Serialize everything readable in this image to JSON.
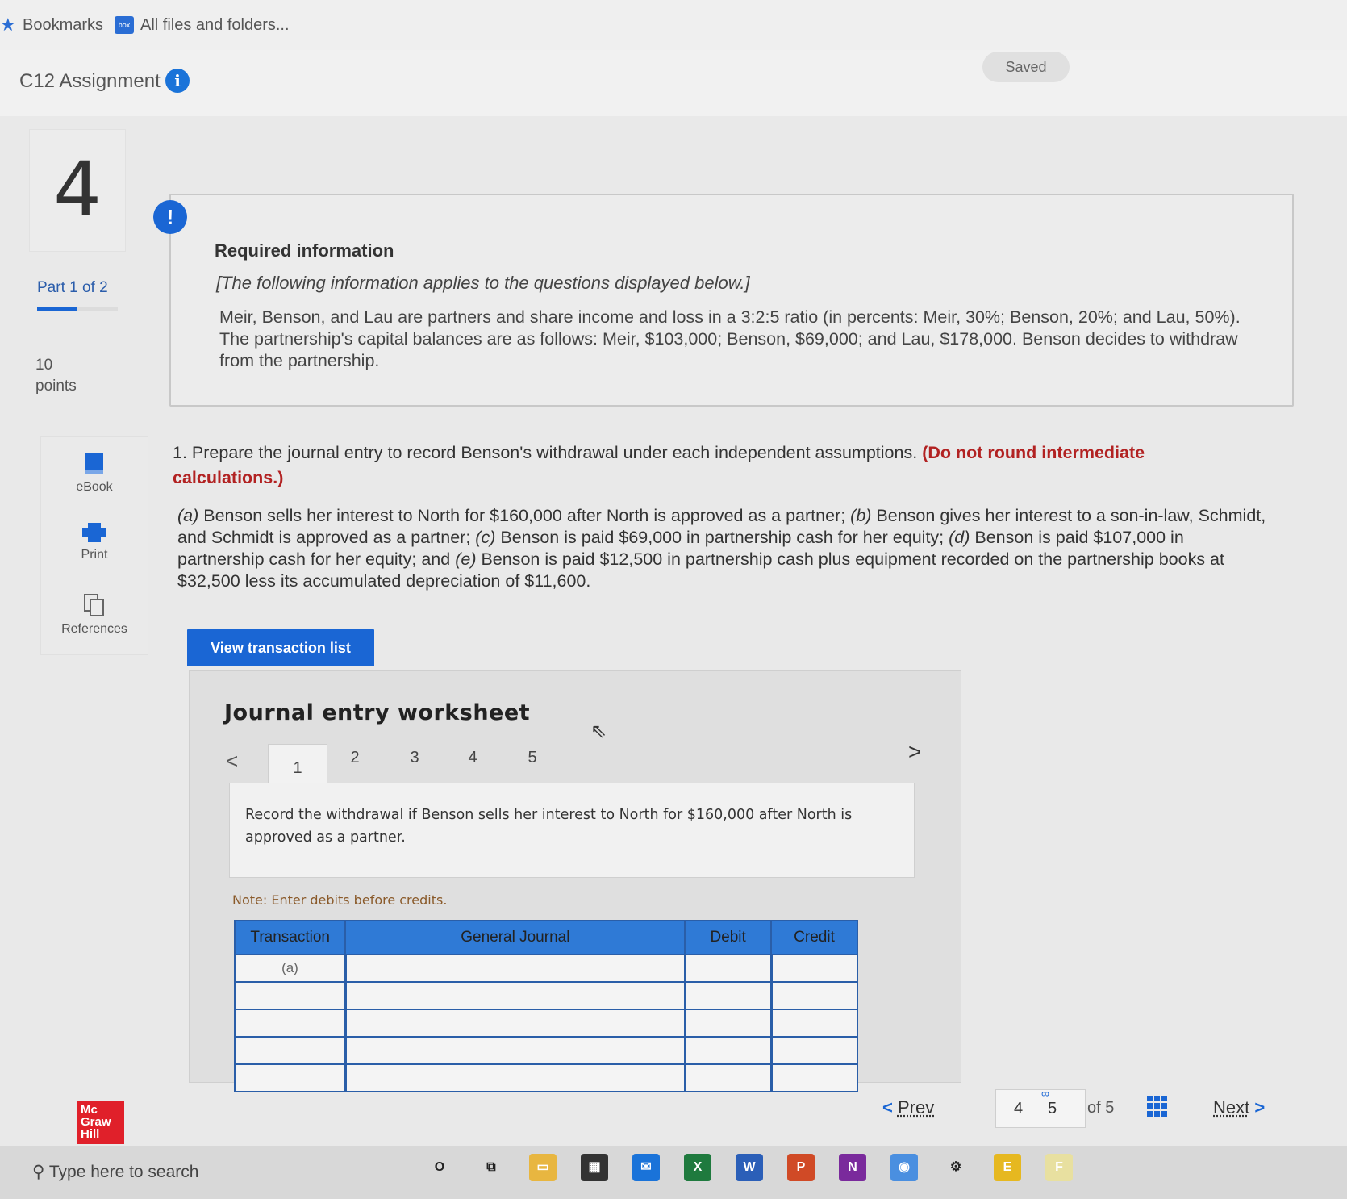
{
  "bookmarks_bar": {
    "bookmarks_label": "Bookmarks",
    "box_icon_text": "box",
    "all_files_label": "All files and folders..."
  },
  "header": {
    "assignment_title": "C12 Assignment",
    "saved_label": "Saved"
  },
  "sidebar": {
    "question_number": "4",
    "part_label": "Part 1 of 2",
    "part_progress": 0.5,
    "points_value": "10",
    "points_label": "points",
    "tools": [
      {
        "label": "eBook",
        "icon": "book-icon"
      },
      {
        "label": "Print",
        "icon": "printer-icon"
      },
      {
        "label": "References",
        "icon": "copy-icon"
      }
    ]
  },
  "required_info": {
    "title": "Required information",
    "subtitle": "[The following information applies to the questions displayed below.]",
    "body": "Meir, Benson, and Lau are partners and share income and loss in a 3:2:5 ratio (in percents: Meir, 30%; Benson, 20%; and Lau, 50%). The partnership's capital balances are as follows: Meir, $103,000; Benson, $69,000; and Lau, $178,000. Benson decides to withdraw from the partnership."
  },
  "question": {
    "prompt": "1. Prepare the journal entry to record Benson's withdrawal under each independent assumptions.",
    "emphasis": "(Do not round intermediate calculations.)",
    "parts": [
      {
        "key": "(a)",
        "text": " Benson sells her interest to North for $160,000 after North is approved as a partner; "
      },
      {
        "key": "(b)",
        "text": " Benson gives her interest to a son-in-law, Schmidt, and Schmidt is approved as a partner; "
      },
      {
        "key": "(c)",
        "text": " Benson is paid $69,000 in partnership cash for her equity; "
      },
      {
        "key": "(d)",
        "text": " Benson is paid $107,000 in partnership cash for her equity; and "
      },
      {
        "key": "(e)",
        "text": " Benson is paid $12,500 in partnership cash plus equipment recorded on the partnership books at $32,500 less its accumulated depreciation of $11,600."
      }
    ]
  },
  "view_transaction_button": "View transaction list",
  "worksheet": {
    "title": "Journal entry worksheet",
    "tabs": [
      "1",
      "2",
      "3",
      "4",
      "5"
    ],
    "active_tab": "1",
    "instruction": "Record the withdrawal if Benson sells her interest to North for $160,000 after North is approved as a partner.",
    "note": "Note: Enter debits before credits.",
    "columns": {
      "transaction": "Transaction",
      "general_journal": "General Journal",
      "debit": "Debit",
      "credit": "Credit"
    },
    "rows": [
      {
        "transaction": "(a)",
        "general_journal": "",
        "debit": "",
        "credit": ""
      },
      {
        "transaction": "",
        "general_journal": "",
        "debit": "",
        "credit": ""
      },
      {
        "transaction": "",
        "general_journal": "",
        "debit": "",
        "credit": ""
      },
      {
        "transaction": "",
        "general_journal": "",
        "debit": "",
        "credit": ""
      },
      {
        "transaction": "",
        "general_journal": "",
        "debit": "",
        "credit": ""
      }
    ]
  },
  "navigation": {
    "prev_label": "Prev",
    "current_page": "4",
    "next_page": "5",
    "of_label": "of 5",
    "next_label": "Next"
  },
  "logo": {
    "line1": "Mc",
    "line2": "Graw",
    "line3": "Hill"
  },
  "taskbar": {
    "search_placeholder": "Type here to search",
    "apps": [
      {
        "name": "cortana-icon",
        "label": "O"
      },
      {
        "name": "task-view-icon",
        "label": "⧉"
      },
      {
        "name": "file-explorer-icon",
        "label": "▭"
      },
      {
        "name": "store-icon",
        "label": "▦"
      },
      {
        "name": "mail-icon",
        "label": "✉"
      },
      {
        "name": "excel-icon",
        "label": "X"
      },
      {
        "name": "word-icon",
        "label": "W"
      },
      {
        "name": "powerpoint-icon",
        "label": "P"
      },
      {
        "name": "onenote-icon",
        "label": "N"
      },
      {
        "name": "chrome-icon",
        "label": "◉"
      },
      {
        "name": "settings-icon",
        "label": "⚙"
      },
      {
        "name": "app-e-icon",
        "label": "E"
      },
      {
        "name": "app-f-icon",
        "label": "F"
      }
    ]
  },
  "colors": {
    "accent": "#1a66d4",
    "table_header": "#2f7ad6",
    "emphasis_red": "#b22222",
    "logo_red": "#e0202a"
  }
}
